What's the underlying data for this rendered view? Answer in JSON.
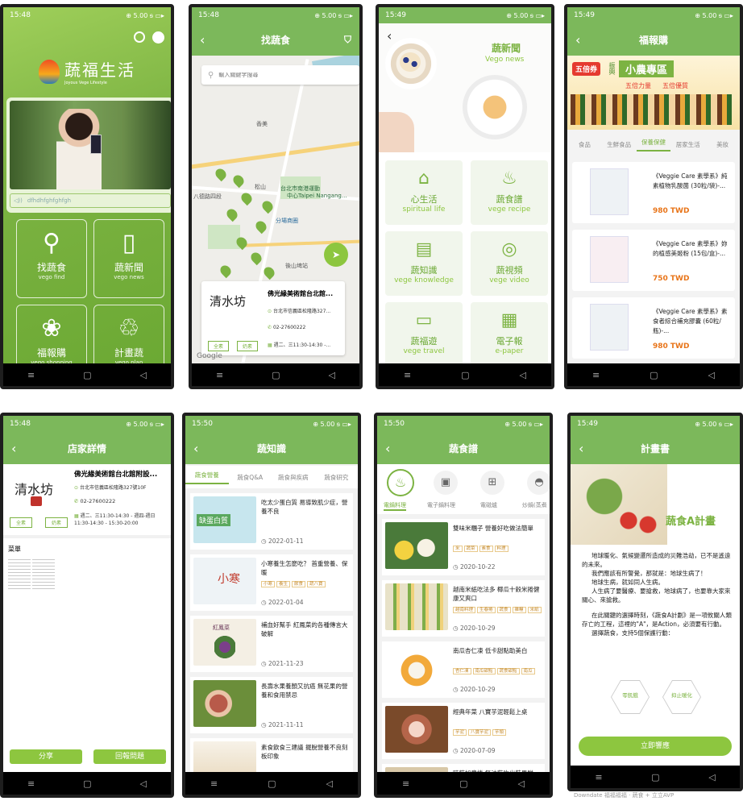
{
  "status": {
    "time1": "15:48",
    "time2": "15:48",
    "time3": "15:49",
    "time4": "15:49",
    "time5": "15:48",
    "time6": "15:50",
    "time7": "15:50",
    "time8": "15:49",
    "icons": "⊕ 5.00 ᵴ ▭▸"
  },
  "nav": {
    "menu": "≡",
    "home": "▢",
    "back": "◁"
  },
  "home": {
    "logo": "蔬福生活",
    "logo_sub": "Joyous Vege Lifestyle",
    "audio": "dfhdhfghfghfgh",
    "tiles": [
      {
        "icon": "⚲",
        "label": "找蔬食",
        "sub": "vego find"
      },
      {
        "icon": "▯",
        "label": "蔬新聞",
        "sub": "vego news"
      },
      {
        "icon": "❀",
        "label": "福報購",
        "sub": "vego shopping"
      },
      {
        "icon": "♲",
        "label": "計畫蔬",
        "sub": "vego plan"
      }
    ]
  },
  "find": {
    "title": "找蔬食",
    "search_placeholder": "輸入關鍵字搜尋",
    "map_labels": [
      "香美",
      "中興路",
      "台北市南港運動",
      "中心Taipei Nangang...",
      "松山",
      "分場商圈",
      "南港站",
      "後山埤站",
      "八德路四段"
    ],
    "shop_logo": "清水坊",
    "shop_name": "佛光緣美術館台北館...",
    "address": "台北市信義區松隆路327...",
    "phone": "02-27600222",
    "hours": "週二、三11:30-14:30 -...",
    "chips": [
      "全素",
      "奶素"
    ],
    "google": "Google"
  },
  "news": {
    "title": "蔬新聞",
    "sub": "Vego news",
    "items": [
      {
        "icon": "⌂",
        "label": "心生活",
        "sub": "spiritual life"
      },
      {
        "icon": "♨",
        "label": "蔬食譜",
        "sub": "vege recipe"
      },
      {
        "icon": "▤",
        "label": "蔬知識",
        "sub": "vege knowledge"
      },
      {
        "icon": "◎",
        "label": "蔬視頻",
        "sub": "vege video"
      },
      {
        "icon": "▭",
        "label": "蔬福遊",
        "sub": "vege travel"
      },
      {
        "icon": "▦",
        "label": "電子報",
        "sub": "e-paper"
      }
    ]
  },
  "shop": {
    "title": "福報購",
    "banner": {
      "brand": "五倍券",
      "big": "小農專區",
      "s1": "五倍力量",
      "s2": "五倍優質",
      "side": "振興"
    },
    "tabs": [
      "食品",
      "生鮮食品",
      "保養保健",
      "居家生活",
      "美妝"
    ],
    "products": [
      {
        "name": "《Veggie Care 素學系》純素植物乳酸菌 (30粒/袋)-...",
        "price": "980 TWD"
      },
      {
        "name": "《Veggie Care 素學系》妳的植感美姬粉 (15包/盒)-...",
        "price": "750 TWD"
      },
      {
        "name": "《Veggie Care 素學系》素食者綜合補充膠囊 (60粒/瓶)-...",
        "price": "980 TWD"
      }
    ]
  },
  "store": {
    "title": "店家詳情",
    "logo": "清水坊",
    "name": "佛光緣美術館台北館附設...",
    "address": "台北市信義區松隆路327號10F",
    "phone": "02-27600222",
    "hours": "週二、三11:30-14:30 - 週四-週日11:30-14:30 - 15:30-20:00",
    "chips": [
      "全素",
      "奶素"
    ],
    "menu": "菜單",
    "share": "分享",
    "report": "回報問題"
  },
  "know": {
    "title": "蔬知識",
    "tabs": [
      "蔬食營養",
      "蔬食Q&A",
      "蔬食與疾病",
      "蔬食研究"
    ],
    "items": [
      {
        "title": "吃太少蛋白質 易導致肌少症，營養不良",
        "thumb": "缺蛋白質",
        "date": "2022-01-11",
        "tags": []
      },
      {
        "title": "小寒養生怎麼吃？ 首重營養、保暖",
        "thumb": "小寒",
        "date": "2022-01-04",
        "tags": [
          "小寒",
          "養生",
          "飲食",
          "蔬八寶"
        ]
      },
      {
        "title": "補血好幫手 紅鳳菜的各種傳言大破解",
        "thumb": "紅鳳菜",
        "date": "2021-11-23",
        "tags": []
      },
      {
        "title": "長壽水果養顏又抗癌 無花果的營養和食用禁忌",
        "thumb": "",
        "date": "2021-11-11",
        "tags": []
      },
      {
        "title": "素食飲食三建議 擺脫營養不良刻板印象",
        "thumb": "",
        "date": "",
        "tags": []
      }
    ]
  },
  "recipe": {
    "title": "蔬食譜",
    "cats": [
      {
        "icon": "♨",
        "label": "電鍋料理"
      },
      {
        "icon": "▣",
        "label": "電子鍋料理"
      },
      {
        "icon": "⊞",
        "label": "電磁爐"
      },
      {
        "icon": "◓",
        "label": "炒鍋(蒸煮"
      }
    ],
    "items": [
      {
        "title": "雙味米糰子 營養好吃做法簡單",
        "tags": [
          "米",
          "蔬菜",
          "素食",
          "料理"
        ],
        "date": "2020-10-22"
      },
      {
        "title": "越南米紙吃法多 椰瓜十穀米捲健康又爽口",
        "tags": [
          "越南料理",
          "生春捲",
          "蔬食",
          "雜糧",
          "米紙"
        ],
        "date": "2020-10-29"
      },
      {
        "title": "南瓜杏仁凍 低卡甜點助美白",
        "tags": [
          "杏仁凍",
          "南瓜甜點",
          "蔬食甜點",
          "南瓜"
        ],
        "date": "2020-10-29"
      },
      {
        "title": "經典年菜 八寶芋泥輕鬆上桌",
        "tags": [
          "芋泥",
          "八寶芋泥",
          "芋頭"
        ],
        "date": "2020-07-09"
      },
      {
        "title": "時蔬如意捲 無油蔬吃出蔬果鮮",
        "tags": [],
        "date": ""
      }
    ]
  },
  "plan": {
    "title": "計畫書",
    "heading": "蔬食A計畫",
    "p1": "地球暖化、氣候變遷所造成的災難浩劫，已不是遙遠的未來。",
    "p2": "我們應該有所警覺，那就是：地球生病了！",
    "p3": "地球生病，就如同人生病。",
    "p4": "人生病了要醫療、要搶救，地球病了，也要靠大家來關心、來搶救。",
    "p5": "在此關鍵的選擇時刻，《蔬食A計劃》是一項攸關人類存亡的工程，這裡的\"A\"，是Action，必須要有行動。",
    "p6": "選擇蔬食，支持5個保護行動：",
    "hex1": "零飢餓",
    "hex2": "抑止暖化",
    "cta": "立即響應",
    "caption": "Downdate 福福福福 · 蔬食 + 立立AVP"
  }
}
